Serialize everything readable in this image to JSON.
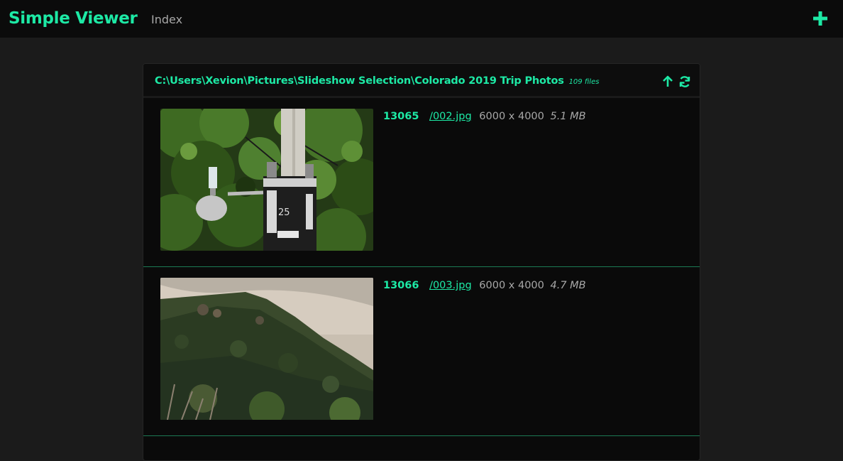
{
  "navbar": {
    "brand": "Simple Viewer",
    "index_label": "Index",
    "add_icon": "plus-icon"
  },
  "colors": {
    "accent": "#1de9a5",
    "background": "#1b1b1b",
    "navbar_bg": "#0b0b0b",
    "panel_bg": "#0a0a0a"
  },
  "folder": {
    "path": "C:\\Users\\Xevion\\Pictures\\Slideshow Selection\\Colorado 2019 Trip Photos",
    "file_count": "109 files",
    "up_icon": "arrow-up-icon",
    "refresh_icon": "refresh-icon"
  },
  "files": [
    {
      "id": "13065",
      "name": "/002.jpg",
      "dimensions": "6000 x 4000",
      "size": "5.1 MB",
      "thumbnail": "utility-pole-with-transformer-and-street-light"
    },
    {
      "id": "13066",
      "name": "/003.jpg",
      "dimensions": "6000 x 4000",
      "size": "4.7 MB",
      "thumbnail": "forested-mountain-slope-under-cloudy-sky"
    }
  ]
}
